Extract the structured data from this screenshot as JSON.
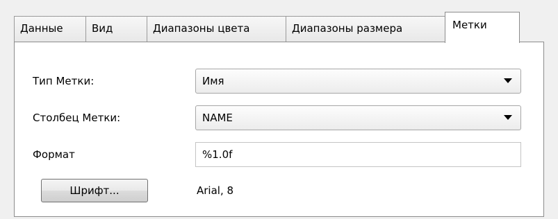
{
  "tabs": [
    {
      "label": "Данные",
      "active": false
    },
    {
      "label": "Вид",
      "active": false
    },
    {
      "label": "Диапазоны цвета",
      "active": false
    },
    {
      "label": "Диапазоны размера",
      "active": false
    },
    {
      "label": "Метки",
      "active": true
    }
  ],
  "form": {
    "label_type": {
      "label": "Тип Метки:",
      "value": "Имя"
    },
    "label_column": {
      "label": "Столбец Метки:",
      "value": "NAME"
    },
    "format": {
      "label": "Формат",
      "value": "%1.0f"
    },
    "font": {
      "button_label": "Шрифт...",
      "value": "Arial, 8"
    }
  }
}
